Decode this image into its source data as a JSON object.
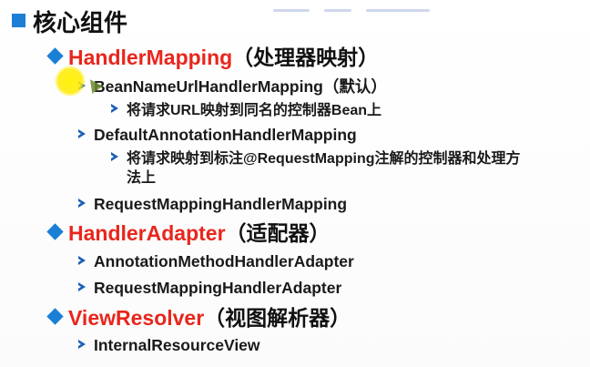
{
  "heading": "核心组件",
  "components": [
    {
      "name": "HandlerMapping",
      "cn": "（处理器映射）",
      "items": [
        {
          "text": "BeanNameUrlHandlerMapping（默认）",
          "desc": [
            "将请求URL映射到同名的控制器Bean上"
          ]
        },
        {
          "text": "DefaultAnnotationHandlerMapping",
          "desc": [
            "将请求映射到标注@RequestMapping注解的控制器和处理方",
            "法上"
          ]
        },
        {
          "text": "RequestMappingHandlerMapping",
          "desc": []
        }
      ]
    },
    {
      "name": "HandlerAdapter",
      "cn": "（适配器）",
      "items": [
        {
          "text": "AnnotationMethodHandlerAdapter",
          "desc": []
        },
        {
          "text": "RequestMappingHandlerAdapter",
          "desc": []
        }
      ]
    },
    {
      "name": "ViewResolver",
      "cn": "（视图解析器）",
      "items": [
        {
          "text": "InternalResourceView",
          "desc": []
        }
      ]
    }
  ],
  "colors": {
    "bullet_blue": "#1c7fd6",
    "title_red": "#e8261d",
    "arrow_blue": "#1c5fb5"
  }
}
